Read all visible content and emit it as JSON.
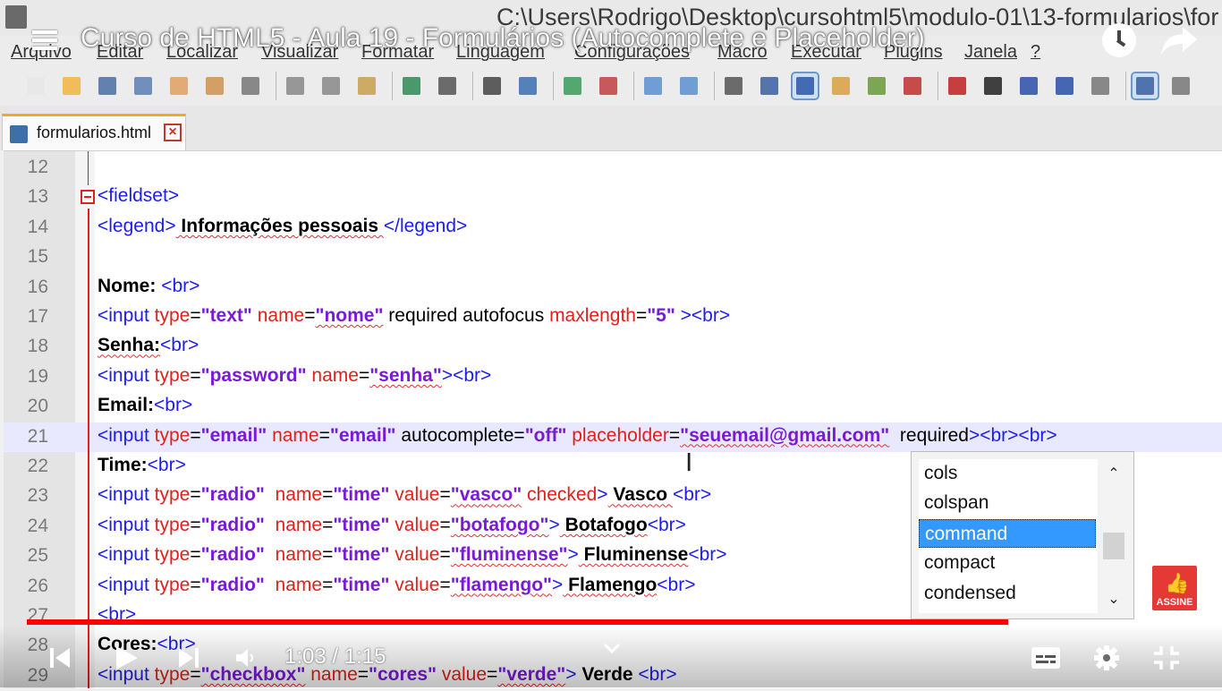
{
  "window": {
    "title": "C:\\Users\\Rodrigo\\Desktop\\cursohtml5\\modulo-01\\13-formularios\\for"
  },
  "menubar": [
    {
      "label": "Arquivo"
    },
    {
      "label": "Editar"
    },
    {
      "label": "Localizar"
    },
    {
      "label": "Visualizar"
    },
    {
      "label": "Formatar"
    },
    {
      "label": "Linguagem"
    },
    {
      "label": "Configurações"
    },
    {
      "label": "Macro"
    },
    {
      "label": "Executar"
    },
    {
      "label": "Plugins"
    },
    {
      "label": "Janela"
    },
    {
      "label": "?"
    }
  ],
  "toolbar": {
    "icons": [
      "new-file",
      "open-file",
      "save",
      "save-all",
      "close",
      "close-all",
      "print",
      "cut",
      "copy",
      "paste",
      "undo",
      "redo",
      "find",
      "replace",
      "zoom-in",
      "zoom-out",
      "sync-vertical",
      "sync-horizontal",
      "word-wrap",
      "show-all-characters",
      "indent-guide",
      "user-language",
      "document-map",
      "function-list",
      "record-macro",
      "stop-macro",
      "play-macro",
      "run-macro-multiple",
      "save-macro",
      "spell-check",
      "more"
    ]
  },
  "tab": {
    "label": "formularios.html",
    "close_glyph": "×"
  },
  "editor": {
    "lines": [
      {
        "num": "12",
        "tokens": []
      },
      {
        "num": "13",
        "tokens": [
          {
            "t": "<fieldset>",
            "c": "tag"
          }
        ]
      },
      {
        "num": "14",
        "tokens": [
          {
            "t": "<legend>",
            "c": "tag"
          },
          {
            "t": " Informações pessoais ",
            "c": "txt bold squig"
          },
          {
            "t": "</legend>",
            "c": "tag"
          }
        ]
      },
      {
        "num": "15",
        "tokens": []
      },
      {
        "num": "16",
        "tokens": [
          {
            "t": "Nome: ",
            "c": "txt bold"
          },
          {
            "t": "<br>",
            "c": "tag"
          }
        ]
      },
      {
        "num": "17",
        "tokens": [
          {
            "t": "<input ",
            "c": "tag"
          },
          {
            "t": "type",
            "c": "attr"
          },
          {
            "t": "=",
            "c": "txt"
          },
          {
            "t": "\"text\"",
            "c": "val"
          },
          {
            "t": " name",
            "c": "attr"
          },
          {
            "t": "=",
            "c": "txt"
          },
          {
            "t": "\"nome\"",
            "c": "val squig"
          },
          {
            "t": " required autofocus ",
            "c": "txt"
          },
          {
            "t": "maxlength",
            "c": "attr"
          },
          {
            "t": "=",
            "c": "txt"
          },
          {
            "t": "\"5\"",
            "c": "val"
          },
          {
            "t": " ><br>",
            "c": "tag"
          }
        ]
      },
      {
        "num": "18",
        "tokens": [
          {
            "t": "Senha:",
            "c": "txt bold squig"
          },
          {
            "t": "<br>",
            "c": "tag"
          }
        ]
      },
      {
        "num": "19",
        "tokens": [
          {
            "t": "<input ",
            "c": "tag"
          },
          {
            "t": "type",
            "c": "attr"
          },
          {
            "t": "=",
            "c": "txt"
          },
          {
            "t": "\"password\"",
            "c": "val"
          },
          {
            "t": " name",
            "c": "attr"
          },
          {
            "t": "=",
            "c": "txt"
          },
          {
            "t": "\"senha\"",
            "c": "val squig"
          },
          {
            "t": "><br>",
            "c": "tag"
          }
        ]
      },
      {
        "num": "20",
        "tokens": [
          {
            "t": "Email:",
            "c": "txt bold"
          },
          {
            "t": "<br>",
            "c": "tag"
          }
        ]
      },
      {
        "num": "21",
        "current": true,
        "tokens": [
          {
            "t": "<input ",
            "c": "tag"
          },
          {
            "t": "type",
            "c": "attr"
          },
          {
            "t": "=",
            "c": "txt"
          },
          {
            "t": "\"email\"",
            "c": "val"
          },
          {
            "t": " name",
            "c": "attr"
          },
          {
            "t": "=",
            "c": "txt"
          },
          {
            "t": "\"email\"",
            "c": "val"
          },
          {
            "t": " autocomplete=",
            "c": "txt"
          },
          {
            "t": "\"off\"",
            "c": "val"
          },
          {
            "t": " placeholder",
            "c": "attr"
          },
          {
            "t": "=",
            "c": "txt"
          },
          {
            "t": "\"seuemail@gmail.com\"",
            "c": "val squig"
          },
          {
            "t": "  required",
            "c": "txt"
          },
          {
            "t": "><br><br>",
            "c": "tag"
          }
        ]
      },
      {
        "num": "22",
        "tokens": [
          {
            "t": "Time:",
            "c": "txt bold"
          },
          {
            "t": "<br>",
            "c": "tag"
          }
        ]
      },
      {
        "num": "23",
        "tokens": [
          {
            "t": "<input ",
            "c": "tag"
          },
          {
            "t": "type",
            "c": "attr"
          },
          {
            "t": "=",
            "c": "txt"
          },
          {
            "t": "\"radio\"",
            "c": "val"
          },
          {
            "t": "  name",
            "c": "attr"
          },
          {
            "t": "=",
            "c": "txt"
          },
          {
            "t": "\"time\"",
            "c": "val"
          },
          {
            "t": " value",
            "c": "attr"
          },
          {
            "t": "=",
            "c": "txt"
          },
          {
            "t": "\"vasco\"",
            "c": "val squig"
          },
          {
            "t": " checked",
            "c": "attr"
          },
          {
            "t": ">",
            "c": "tag"
          },
          {
            "t": " Vasco ",
            "c": "txt bold squig"
          },
          {
            "t": "<br>",
            "c": "tag"
          }
        ]
      },
      {
        "num": "24",
        "tokens": [
          {
            "t": "<input ",
            "c": "tag"
          },
          {
            "t": "type",
            "c": "attr"
          },
          {
            "t": "=",
            "c": "txt"
          },
          {
            "t": "\"radio\"",
            "c": "val"
          },
          {
            "t": "  name",
            "c": "attr"
          },
          {
            "t": "=",
            "c": "txt"
          },
          {
            "t": "\"time\"",
            "c": "val"
          },
          {
            "t": " value",
            "c": "attr"
          },
          {
            "t": "=",
            "c": "txt"
          },
          {
            "t": "\"botafogo\"",
            "c": "val squig"
          },
          {
            "t": ">",
            "c": "tag"
          },
          {
            "t": " Botafogo",
            "c": "txt bold squig"
          },
          {
            "t": "<br>",
            "c": "tag"
          }
        ]
      },
      {
        "num": "25",
        "tokens": [
          {
            "t": "<input ",
            "c": "tag"
          },
          {
            "t": "type",
            "c": "attr"
          },
          {
            "t": "=",
            "c": "txt"
          },
          {
            "t": "\"radio\"",
            "c": "val"
          },
          {
            "t": "  name",
            "c": "attr"
          },
          {
            "t": "=",
            "c": "txt"
          },
          {
            "t": "\"time\"",
            "c": "val"
          },
          {
            "t": " value",
            "c": "attr"
          },
          {
            "t": "=",
            "c": "txt"
          },
          {
            "t": "\"fluminense\"",
            "c": "val squig"
          },
          {
            "t": ">",
            "c": "tag"
          },
          {
            "t": " Fluminense",
            "c": "txt bold squig"
          },
          {
            "t": "<br>",
            "c": "tag"
          }
        ]
      },
      {
        "num": "26",
        "tokens": [
          {
            "t": "<input ",
            "c": "tag"
          },
          {
            "t": "type",
            "c": "attr"
          },
          {
            "t": "=",
            "c": "txt"
          },
          {
            "t": "\"radio\"",
            "c": "val"
          },
          {
            "t": "  name",
            "c": "attr"
          },
          {
            "t": "=",
            "c": "txt"
          },
          {
            "t": "\"time\"",
            "c": "val"
          },
          {
            "t": " value",
            "c": "attr"
          },
          {
            "t": "=",
            "c": "txt"
          },
          {
            "t": "\"flamengo\"",
            "c": "val squig"
          },
          {
            "t": ">",
            "c": "tag"
          },
          {
            "t": " Flamengo",
            "c": "txt bold squig"
          },
          {
            "t": "<br>",
            "c": "tag"
          }
        ]
      },
      {
        "num": "27",
        "tokens": [
          {
            "t": "<br>",
            "c": "tag"
          }
        ]
      },
      {
        "num": "28",
        "tokens": [
          {
            "t": "Cores:",
            "c": "txt bold"
          },
          {
            "t": "<br>",
            "c": "tag"
          }
        ]
      },
      {
        "num": "29",
        "tokens": [
          {
            "t": "<input ",
            "c": "tag"
          },
          {
            "t": "type",
            "c": "attr"
          },
          {
            "t": "=",
            "c": "txt"
          },
          {
            "t": "\"checkbox\"",
            "c": "val squig"
          },
          {
            "t": " name",
            "c": "attr"
          },
          {
            "t": "=",
            "c": "txt"
          },
          {
            "t": "\"cores\"",
            "c": "val"
          },
          {
            "t": " value",
            "c": "attr"
          },
          {
            "t": "=",
            "c": "txt"
          },
          {
            "t": "\"verde\"",
            "c": "val squig"
          },
          {
            "t": ">",
            "c": "tag"
          },
          {
            "t": " Verde ",
            "c": "txt bold"
          },
          {
            "t": "<br>",
            "c": "tag"
          }
        ]
      }
    ]
  },
  "autocomplete": {
    "items": [
      "cols",
      "colspan",
      "command",
      "compact",
      "condensed"
    ],
    "selected": "command",
    "up_glyph": "⌃",
    "down_glyph": "⌄"
  },
  "video": {
    "title": "Curso de HTML5 - Aula 19 - Formulários (Autocomplete e Placeholder)",
    "time": "1:03 / 1:15",
    "progress_fraction": 0.84,
    "subscribe_label": "ASSINE",
    "colors": {
      "progress": "#ff0000",
      "subscribe": "#e53935"
    }
  }
}
